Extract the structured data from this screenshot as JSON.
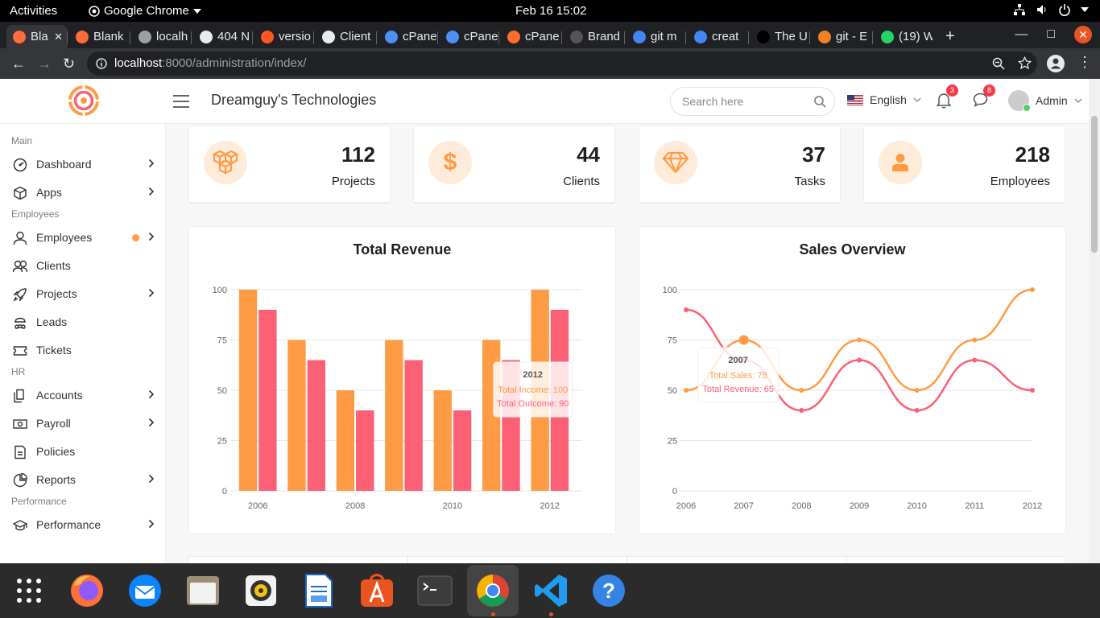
{
  "topbar": {
    "activities": "Activities",
    "app": "Google Chrome",
    "clock": "Feb 16  15:02"
  },
  "browser": {
    "tabs": [
      {
        "title": "Bla",
        "favicon_color": "#ff6b3d"
      },
      {
        "title": "Blank",
        "favicon_color": "#ff6b3d"
      },
      {
        "title": "localh",
        "favicon_color": "#9aa0a6"
      },
      {
        "title": "404 N",
        "favicon_color": "#e8eaed"
      },
      {
        "title": "versio",
        "favicon_color": "#ff5722"
      },
      {
        "title": "Client",
        "favicon_color": "#e8eaed"
      },
      {
        "title": "cPane",
        "favicon_color": "#4e8ff7"
      },
      {
        "title": "cPane",
        "favicon_color": "#4e8ff7"
      },
      {
        "title": "cPane",
        "favicon_color": "#ff6c2c"
      },
      {
        "title": "Brand",
        "favicon_color": "#555"
      },
      {
        "title": "git m",
        "favicon_color": "#4285f4"
      },
      {
        "title": "creat",
        "favicon_color": "#4285f4"
      },
      {
        "title": "The U",
        "favicon_color": "#000"
      },
      {
        "title": "git - E",
        "favicon_color": "#f48024"
      },
      {
        "title": "(19) W",
        "favicon_color": "#25d366"
      }
    ],
    "url_host": "localhost",
    "url_path": ":8000/administration/index/"
  },
  "header": {
    "company": "Dreamguy's Technologies",
    "search_placeholder": "Search here",
    "language": "English",
    "notifications_count": "3",
    "messages_count": "8",
    "user": "Admin"
  },
  "sidebar": {
    "sections": [
      {
        "title": "Main",
        "items": [
          {
            "label": "Dashboard",
            "icon": "dashboard-icon",
            "arrow": true
          },
          {
            "label": "Apps",
            "icon": "cube-icon",
            "arrow": true
          }
        ]
      },
      {
        "title": "Employees",
        "items": [
          {
            "label": "Employees",
            "icon": "user-icon",
            "arrow": true,
            "dot": true
          },
          {
            "label": "Clients",
            "icon": "users-icon"
          },
          {
            "label": "Projects",
            "icon": "rocket-icon",
            "arrow": true
          },
          {
            "label": "Leads",
            "icon": "ed-icon"
          },
          {
            "label": "Tickets",
            "icon": "ticket-icon"
          }
        ]
      },
      {
        "title": "HR",
        "items": [
          {
            "label": "Accounts",
            "icon": "files-icon",
            "arrow": true
          },
          {
            "label": "Payroll",
            "icon": "money-icon",
            "arrow": true
          },
          {
            "label": "Policies",
            "icon": "document-icon"
          },
          {
            "label": "Reports",
            "icon": "pie-icon",
            "arrow": true
          }
        ]
      },
      {
        "title": "Performance",
        "items": [
          {
            "label": "Performance",
            "icon": "graduation-icon",
            "arrow": true
          }
        ]
      }
    ]
  },
  "stats": [
    {
      "value": "112",
      "label": "Projects",
      "icon": "cubes-icon"
    },
    {
      "value": "44",
      "label": "Clients",
      "icon": "dollar-icon"
    },
    {
      "value": "37",
      "label": "Tasks",
      "icon": "diamond-icon"
    },
    {
      "value": "218",
      "label": "Employees",
      "icon": "user-icon"
    }
  ],
  "colors": {
    "orange": "#ff9b44",
    "pink": "#fc6075",
    "accent": "#ff9b44"
  },
  "chart_data": [
    {
      "type": "bar",
      "title": "Total Revenue",
      "categories": [
        "2006",
        "2007",
        "2008",
        "2009",
        "2010",
        "2011",
        "2012"
      ],
      "x_tick_labels": [
        "2006",
        "2008",
        "2010",
        "2012"
      ],
      "series": [
        {
          "name": "Total Income",
          "values": [
            100,
            75,
            50,
            75,
            50,
            75,
            100
          ]
        },
        {
          "name": "Total Outcome",
          "values": [
            90,
            65,
            40,
            65,
            40,
            65,
            90
          ]
        }
      ],
      "ylim": [
        0,
        100
      ],
      "yticks": [
        0,
        25,
        50,
        75,
        100
      ],
      "grid": true,
      "tooltip": {
        "category": "2012",
        "lines": [
          "Total Income: 100",
          "Total Outcome: 90"
        ]
      }
    },
    {
      "type": "line",
      "title": "Sales Overview",
      "x": [
        "2006",
        "2007",
        "2008",
        "2009",
        "2010",
        "2011",
        "2012"
      ],
      "series": [
        {
          "name": "Total Sales",
          "values": [
            50,
            75,
            50,
            75,
            50,
            75,
            100
          ]
        },
        {
          "name": "Total Revenue",
          "values": [
            90,
            65,
            40,
            65,
            40,
            65,
            50
          ]
        }
      ],
      "ylim": [
        0,
        100
      ],
      "yticks": [
        0,
        25,
        50,
        75,
        100
      ],
      "grid": true,
      "tooltip": {
        "category": "2007",
        "lines": [
          "Total Sales: 75",
          "Total Revenue: 65"
        ]
      }
    }
  ]
}
